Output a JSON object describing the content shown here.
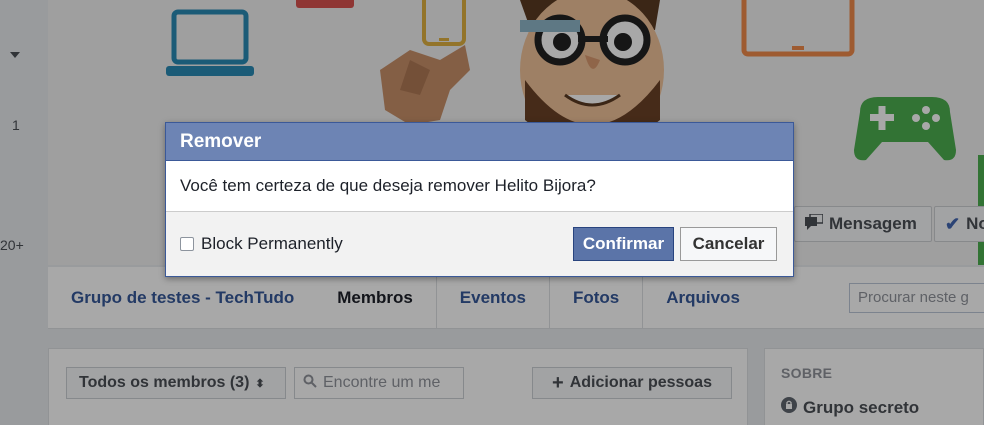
{
  "left_strip": {
    "num1": "1",
    "num2": "20+"
  },
  "cover": {
    "actions": {
      "message_label": "Mensagem",
      "notifications_label": "No"
    }
  },
  "nav": {
    "group_name": "Grupo de testes - TechTudo",
    "tabs": [
      {
        "label": "Membros",
        "active": true
      },
      {
        "label": "Eventos"
      },
      {
        "label": "Fotos"
      },
      {
        "label": "Arquivos"
      }
    ],
    "search_placeholder": "Procurar neste g"
  },
  "members": {
    "filter_label": "Todos os membros (3)",
    "search_placeholder": "Encontre um me",
    "add_button_label": "Adicionar pessoas"
  },
  "about": {
    "heading": "SOBRE",
    "privacy_label": "Grupo secreto"
  },
  "dialog": {
    "title": "Remover",
    "message": "Você tem certeza de que deseja remover Helito Bijora?",
    "checkbox_label": "Block Permanently",
    "checkbox_checked": false,
    "confirm_label": "Confirmar",
    "cancel_label": "Cancelar"
  },
  "colors": {
    "dialog_header": "#6d84b4",
    "confirm_button": "#5b74a8",
    "link_blue": "#365899"
  }
}
